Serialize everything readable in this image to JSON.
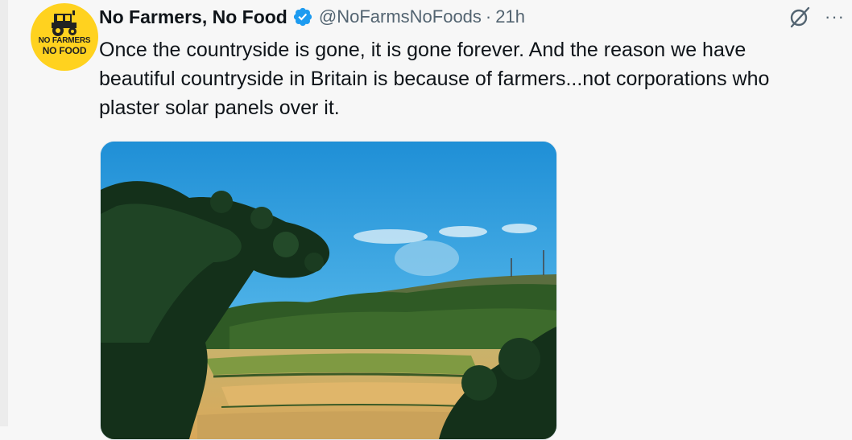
{
  "tweet": {
    "display_name": "No Farmers, No Food",
    "handle": "@NoFarmsNoFoods",
    "separator": "·",
    "time": "21h",
    "text": "Once the countryside is gone, it is gone forever. And the reason we have beautiful countryside in Britain is because of farmers...not corporations who plaster solar panels over it.",
    "more_label": "···",
    "avatar": {
      "line1": "NO FARMERS",
      "line2": "NO FOOD",
      "background": "#ffd21f"
    },
    "verified_color": "#1d9bf0",
    "icons": {
      "verified": "verified-badge-icon",
      "grok": "grok-icon",
      "more": "more-icon",
      "tractor": "tractor-icon"
    }
  }
}
